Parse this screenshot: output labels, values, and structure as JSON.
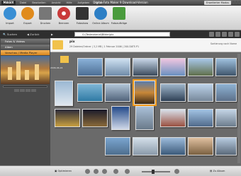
{
  "app": {
    "logo": "MAGIX",
    "title": "Digital Foto Maker 9 Download-Version",
    "extended_mode": "Erweiterter Modus",
    "menu": [
      "Datei",
      "Bearbeiten",
      "Ansicht",
      "Hilfe",
      "Aufgaben",
      "Online"
    ]
  },
  "toolbar": [
    {
      "label": "Import",
      "icon": "import-icon",
      "color": "#3a8fd4"
    },
    {
      "label": "Export",
      "icon": "export-icon",
      "color": "#e08b1d"
    },
    {
      "label": "Drucken",
      "icon": "printer-icon",
      "color": "#777777"
    },
    {
      "label": "Brennen",
      "icon": "disc-icon",
      "color": "#c93a3a"
    },
    {
      "label": "Fotoshow",
      "icon": "filmstrip-icon",
      "color": "#333333"
    },
    {
      "label": "Online Album",
      "icon": "globe-icon",
      "color": "#2d7fc5"
    },
    {
      "label": "Fotoaufträge",
      "icon": "photo-order-icon",
      "color": "#4a9b3d"
    }
  ],
  "nav": {
    "search": "Suchen",
    "back": "Zurück",
    "path": "G:\\Testmaterial\\Bilder\\pix"
  },
  "sidebar": {
    "sections": [
      "Fotos & Videos",
      "Alben",
      "Vorschau / Media Player"
    ]
  },
  "folder": {
    "name": "pix",
    "info": "29 Dateien/Ordner | 3,2 MB | 1 Februar 2006 | 200.DATE.P1",
    "sort": "Sortierung nach Name",
    "date_label": "2006-06-24"
  },
  "bottom": {
    "optimize": "Optimieren",
    "to_album": "Zu Album"
  }
}
